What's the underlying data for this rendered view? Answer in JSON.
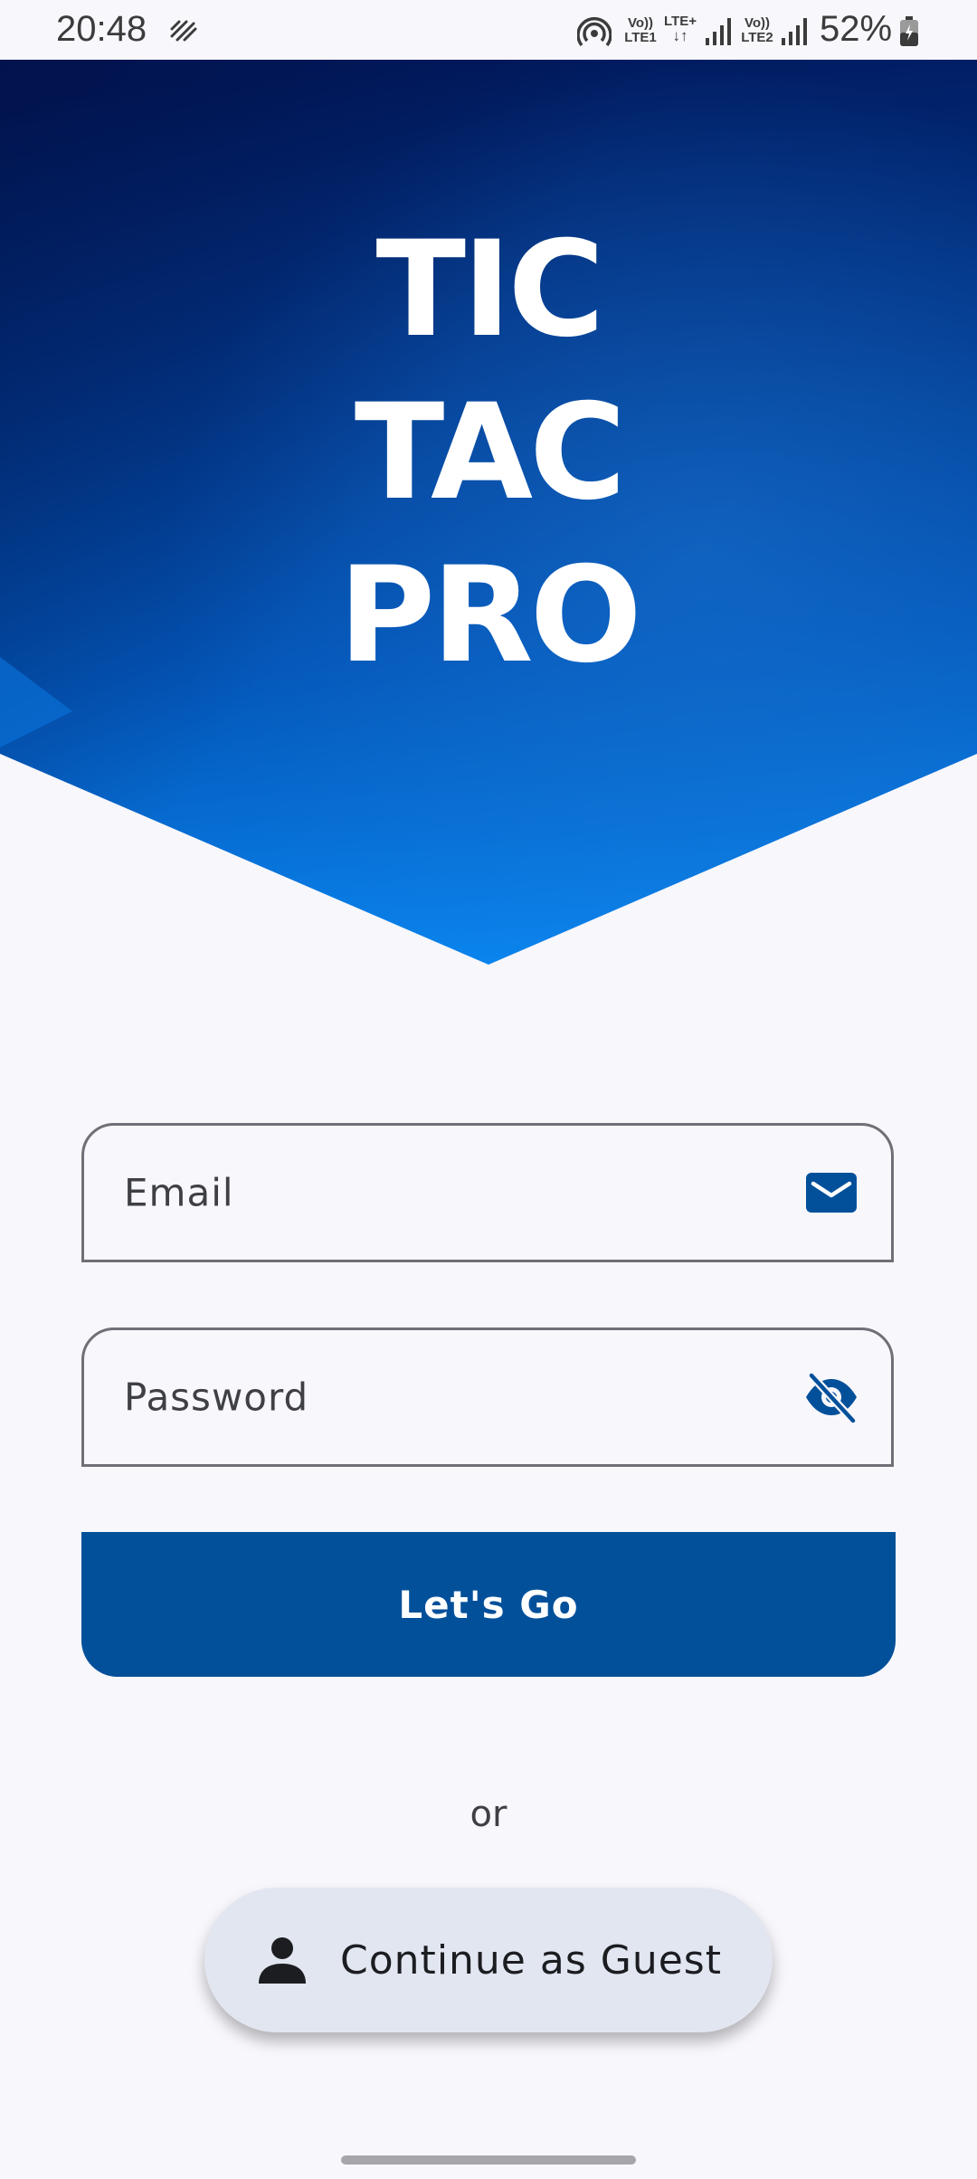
{
  "status_bar": {
    "time": "20:48",
    "battery": "52%",
    "sim1_label_top": "Vo))",
    "sim1_label_bottom": "LTE1",
    "data_label": "LTE+",
    "sim2_label_top": "Vo))",
    "sim2_label_bottom": "LTE2",
    "icons": [
      "mobile-data-pattern-icon",
      "hotspot-icon",
      "data-arrows-icon",
      "signal-icon",
      "signal-icon",
      "battery-charging-icon"
    ]
  },
  "hero": {
    "title_lines": [
      "TIC",
      "TAC",
      "PRO"
    ],
    "colors": {
      "dark": "#011A5E",
      "mid": "#02439A",
      "light": "#0A86F0"
    }
  },
  "form": {
    "email_label": "Email",
    "email_icon": "mail-icon",
    "password_label": "Password",
    "password_icon": "visibility-off-icon",
    "submit_label": "Let's Go",
    "or_text": "or",
    "guest_label": "Continue as Guest",
    "guest_icon": "person-icon"
  },
  "colors": {
    "primary": "#03509A",
    "background": "#F8F7FC",
    "guest_button": "#E2E6F0",
    "outline": "#6F7077"
  }
}
